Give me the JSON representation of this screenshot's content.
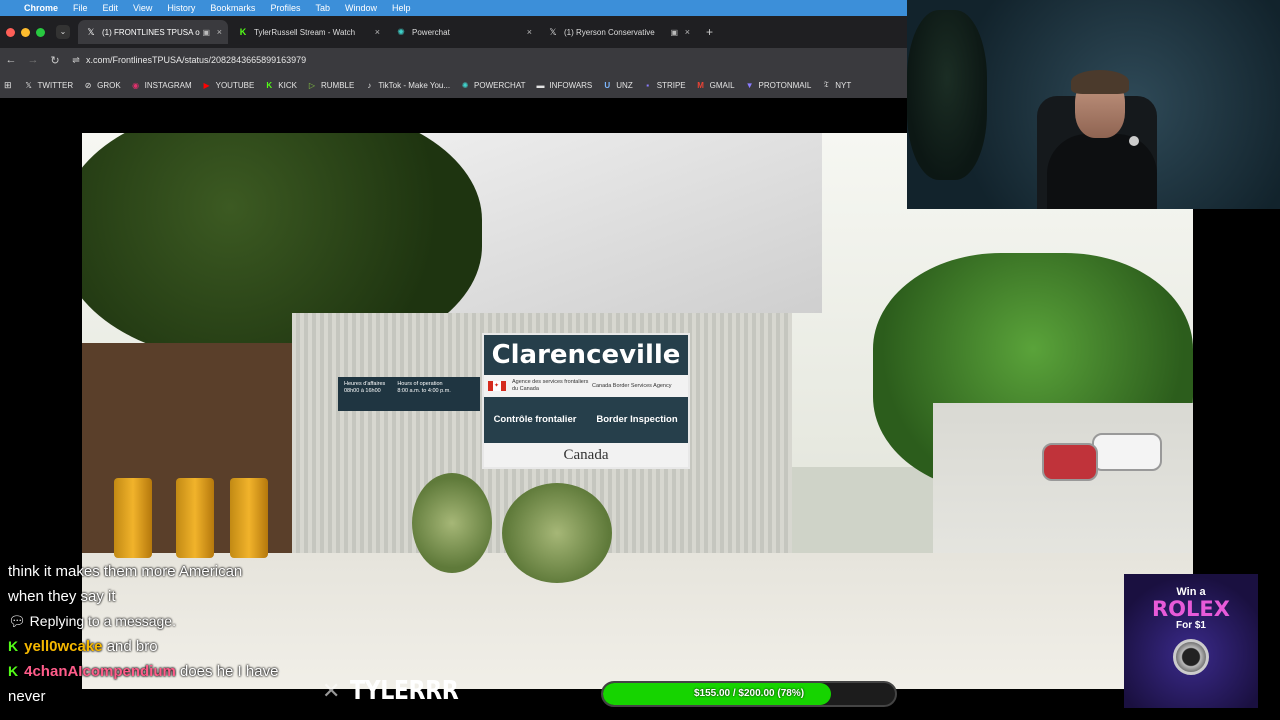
{
  "menubar": {
    "app": "Chrome",
    "items": [
      "File",
      "Edit",
      "View",
      "History",
      "Bookmarks",
      "Profiles",
      "Tab",
      "Window",
      "Help"
    ]
  },
  "tabs": [
    {
      "icon": "x-logo-icon",
      "title": "(1) FRONTLINES TPUSA o",
      "active": true
    },
    {
      "icon": "kick-logo-icon",
      "title": "TylerRussell Stream - Watch",
      "active": false
    },
    {
      "icon": "powerchat-logo-icon",
      "title": "Powerchat",
      "active": false
    },
    {
      "icon": "x-logo-icon",
      "title": "(1) Ryerson Conservative",
      "active": false
    }
  ],
  "address": {
    "url": "x.com/FrontlinesTPUSA/status/2082843665899163979"
  },
  "bookmarks": [
    {
      "icon": "x-logo-icon",
      "label": "TWITTER"
    },
    {
      "icon": "grok-icon",
      "label": "GROK"
    },
    {
      "icon": "instagram-icon",
      "label": "INSTAGRAM"
    },
    {
      "icon": "youtube-icon",
      "label": "YOUTUBE"
    },
    {
      "icon": "kick-icon",
      "label": "KICK"
    },
    {
      "icon": "rumble-icon",
      "label": "RUMBLE"
    },
    {
      "icon": "tiktok-icon",
      "label": "TikTok - Make You..."
    },
    {
      "icon": "powerchat-icon",
      "label": "POWERCHAT"
    },
    {
      "icon": "infowars-icon",
      "label": "INFOWARS"
    },
    {
      "icon": "unz-icon",
      "label": "UNZ"
    },
    {
      "icon": "stripe-icon",
      "label": "STRIPE"
    },
    {
      "icon": "gmail-icon",
      "label": "GMAIL"
    },
    {
      "icon": "protonmail-icon",
      "label": "PROTONMAIL"
    },
    {
      "icon": "nyt-icon",
      "label": "NYT"
    }
  ],
  "video": {
    "sign": {
      "place": "Clarenceville",
      "agency_fr": "Agence des services frontaliers du Canada",
      "agency_en": "Canada Border Services Agency",
      "service_fr": "Contrôle frontalier",
      "service_en": "Border Inspection",
      "wordmark": "Canada"
    },
    "hours": {
      "fr_label": "Heures d'affaires",
      "fr_value": "08h00 à 16h00",
      "en_label": "Hours of operation",
      "en_value": "8:00 a.m. to 4:00 p.m."
    }
  },
  "chat": {
    "line1": "think it makes them more American",
    "line2": "when they say it",
    "reply_icon": "speech-bubble-icon",
    "reply_text": "Replying to a message.",
    "messages": [
      {
        "badge": "K",
        "user": "yell0wcake",
        "text": "and bro"
      },
      {
        "badge": "K",
        "user": "4chanAIcompendium",
        "text": "does he I have never"
      }
    ]
  },
  "watermark": {
    "logo": "x-logo-icon",
    "name": "TYLERRR"
  },
  "goal": {
    "label": "$155.00 / $200.00 (78%)",
    "progress": 0.78,
    "color": "#16d400"
  },
  "ad": {
    "win": "Win a",
    "brand": "ROLEX",
    "price": "For $1"
  }
}
